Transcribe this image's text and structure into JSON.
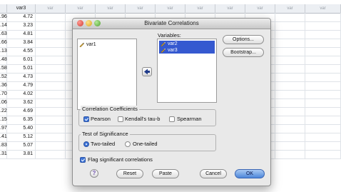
{
  "spreadsheet": {
    "columns": [
      "",
      "var3",
      "var",
      "var",
      "var",
      "var",
      "var",
      "var",
      "var",
      "var",
      "var",
      "var"
    ],
    "col1_values": [
      ".96",
      ".14",
      ".63",
      ".66",
      ".13",
      ".48",
      ".58",
      ".52",
      ".36",
      ".70",
      ".06",
      ".22",
      ".15",
      ".97",
      ".41",
      ".83",
      ".31"
    ],
    "var3_values": [
      "4.72",
      "3.23",
      "4.81",
      "3.84",
      "4.55",
      "6.01",
      "5.01",
      "4.73",
      "4.79",
      "4.02",
      "3.62",
      "4.69",
      "6.35",
      "5.40",
      "5.12",
      "5.07",
      "3.81"
    ]
  },
  "dialog": {
    "title": "Bivariate Correlations",
    "source_list": {
      "items": [
        {
          "label": "var1",
          "icon": "ruler-pencil-icon"
        }
      ]
    },
    "variables_label": "Variables:",
    "variables_list": {
      "items": [
        {
          "label": "var2",
          "icon": "ruler-pencil-icon"
        },
        {
          "label": "var3",
          "icon": "ruler-pencil-icon"
        }
      ]
    },
    "buttons": {
      "options": "Options...",
      "bootstrap": "Bootstrap..."
    },
    "coefficients": {
      "legend": "Correlation Coefficients",
      "pearson": {
        "label": "Pearson",
        "checked": true
      },
      "kendall": {
        "label": "Kendall's tau-b",
        "checked": false
      },
      "spearman": {
        "label": "Spearman",
        "checked": false
      }
    },
    "significance": {
      "legend": "Test of Significance",
      "two_tailed": {
        "label": "Two-tailed",
        "selected": true
      },
      "one_tailed": {
        "label": "One-tailed",
        "selected": false
      }
    },
    "flag": {
      "label": "Flag significant correlations",
      "checked": true
    },
    "footer": {
      "help": "?",
      "reset": "Reset",
      "paste": "Paste",
      "cancel": "Cancel",
      "ok": "OK"
    }
  },
  "colors": {
    "selection": "#3559d0",
    "default_button": "#4d86d9"
  }
}
